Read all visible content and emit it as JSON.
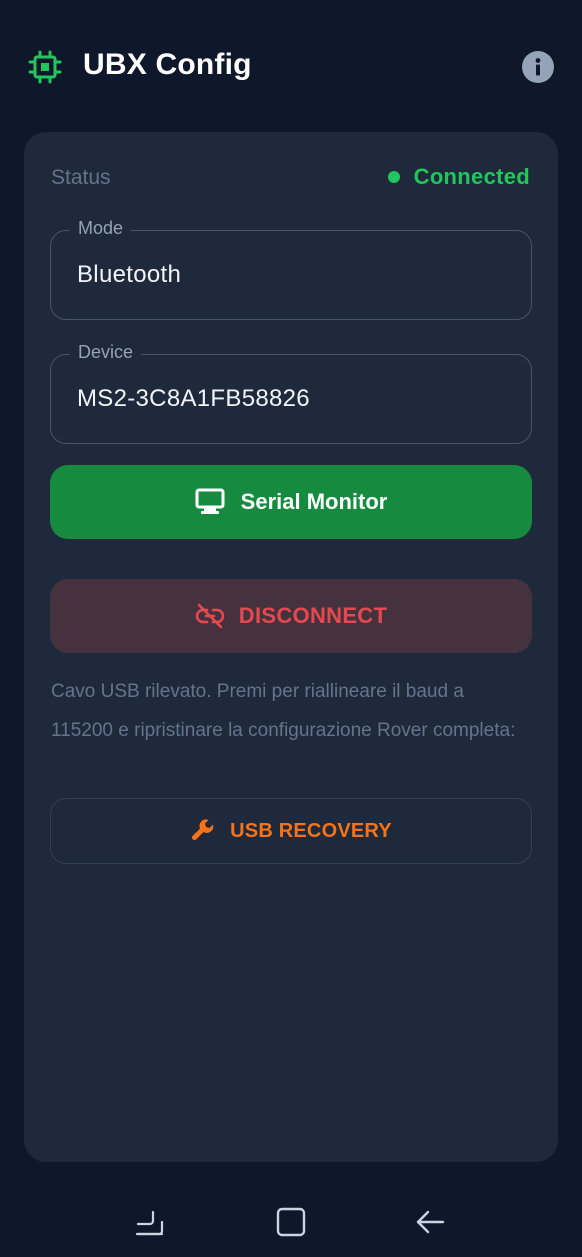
{
  "header": {
    "title": "UBX Config",
    "logo_icon": "chip-icon",
    "info_icon": "info-icon"
  },
  "status": {
    "label": "Status",
    "value": "Connected",
    "color": "#22c55e"
  },
  "fields": {
    "mode": {
      "label": "Mode",
      "value": "Bluetooth"
    },
    "device": {
      "label": "Device",
      "value": "MS2-3C8A1FB58826"
    }
  },
  "buttons": {
    "serial_monitor": {
      "label": "Serial Monitor",
      "icon": "monitor-icon",
      "color": "#168a3e"
    },
    "disconnect": {
      "label": "DISCONNECT",
      "icon": "link-off-icon",
      "color": "#e5484d"
    },
    "usb_recovery": {
      "label": "USB RECOVERY",
      "icon": "wrench-icon",
      "color": "#f97316"
    }
  },
  "recovery_note": "Cavo USB rilevato. Premi per riallineare il baud a 115200 e ripristinare la configurazione Rover completa:",
  "navbar": {
    "recent_icon": "recent-apps-icon",
    "home_icon": "home-icon",
    "back_icon": "back-arrow-icon"
  }
}
